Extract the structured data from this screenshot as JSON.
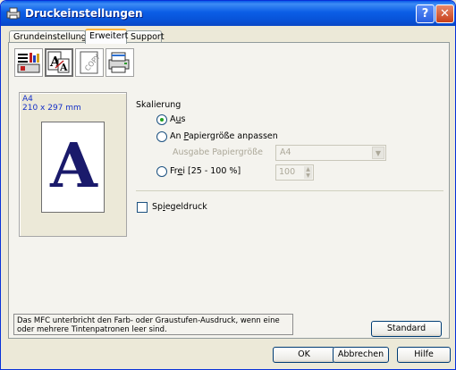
{
  "window": {
    "title": "Druckeinstellungen",
    "help_label": "?",
    "close_label": "✕"
  },
  "tabs": [
    {
      "label": "Grundeinstellungen"
    },
    {
      "label": "Erweitert"
    },
    {
      "label": "Support"
    }
  ],
  "toolbar_icons": [
    "print-quality-icon",
    "scaling-icon",
    "copy-watermark-icon",
    "device-options-icon"
  ],
  "preview": {
    "paper": "A4",
    "size": "210 x 297 mm",
    "glyph": "A"
  },
  "scaling": {
    "heading": "Skalierung",
    "off": {
      "label_pre": "A",
      "label_u": "u",
      "label_post": "s"
    },
    "fit": {
      "label_pre": "An ",
      "label_u": "P",
      "label_post": "apiergröße anpassen"
    },
    "output_size_label": "Ausgabe Papiergröße",
    "output_size_value": "A4",
    "free": {
      "label_pre": "Fr",
      "label_u": "e",
      "label_post": "i [25 - 100 %]"
    },
    "free_value": "100"
  },
  "mirror": {
    "label_pre": "Sp",
    "label_u": "i",
    "label_post": "egeldruck"
  },
  "info_text": "Das MFC unterbricht den Farb- oder Graustufen-Ausdruck, wenn eine oder mehrere Tintenpatronen leer sind.",
  "buttons": {
    "standard": "Standard",
    "ok": "OK",
    "cancel": "Abbrechen",
    "help": "Hilfe"
  }
}
